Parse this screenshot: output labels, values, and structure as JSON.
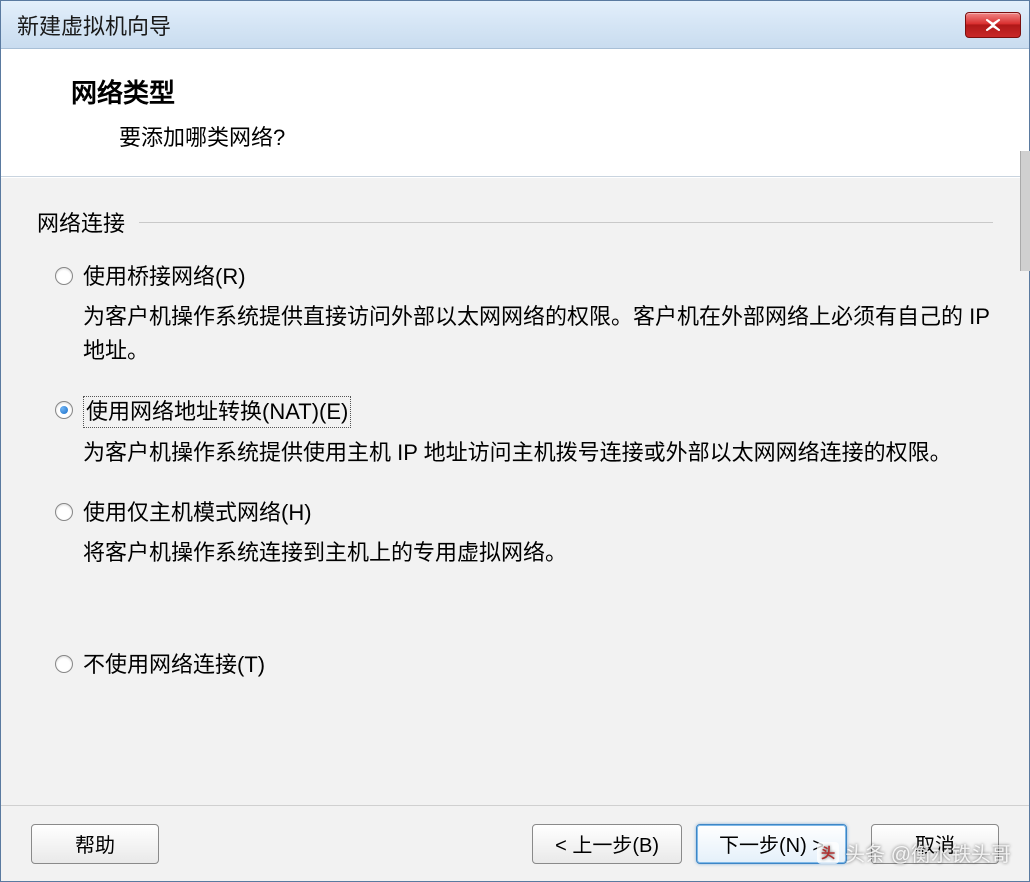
{
  "window": {
    "title": "新建虚拟机向导",
    "close_label": "X"
  },
  "header": {
    "title": "网络类型",
    "subtitle": "要添加哪类网络?"
  },
  "group": {
    "label": "网络连接"
  },
  "options": {
    "bridged": {
      "label": "使用桥接网络(R)",
      "desc": "为客户机操作系统提供直接访问外部以太网网络的权限。客户机在外部网络上必须有自己的 IP 地址。",
      "checked": false
    },
    "nat": {
      "label": "使用网络地址转换(NAT)(E)",
      "desc": "为客户机操作系统提供使用主机 IP 地址访问主机拨号连接或外部以太网网络连接的权限。",
      "checked": true
    },
    "hostonly": {
      "label": "使用仅主机模式网络(H)",
      "desc": "将客户机操作系统连接到主机上的专用虚拟网络。",
      "checked": false
    },
    "none": {
      "label": "不使用网络连接(T)",
      "checked": false
    }
  },
  "buttons": {
    "help": "帮助",
    "back": "< 上一步(B)",
    "next": "下一步(N) >",
    "cancel": "取消"
  },
  "watermark": {
    "text": "头条 @衡水铁头哥"
  }
}
